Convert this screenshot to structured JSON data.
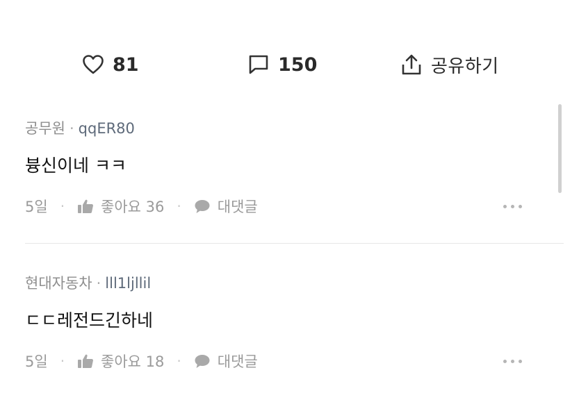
{
  "actions": {
    "like_count": "81",
    "comment_count": "150",
    "share_label": "공유하기"
  },
  "comments": [
    {
      "company": "공무원",
      "author": "qqER80",
      "text": "븅신이네 ㅋㅋ",
      "time": "5일",
      "like_label": "좋아요 36",
      "reply_label": "대댓글"
    },
    {
      "company": "현대자동차",
      "author": "lll1ljllil",
      "text": "ㄷㄷ레전드긴하네",
      "time": "5일",
      "like_label": "좋아요 18",
      "reply_label": "대댓글"
    }
  ],
  "icons": {
    "like": "heart-icon",
    "comment": "speech-bubble-icon",
    "share": "share-upload-icon",
    "thumb": "thumbs-up-icon",
    "reply": "chat-bubble-icon",
    "more": "more-dots-icon"
  }
}
